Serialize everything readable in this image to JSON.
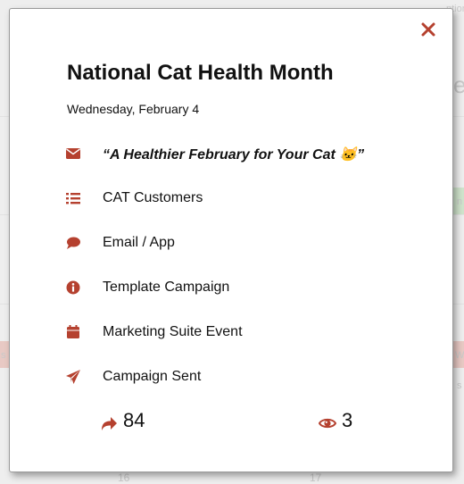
{
  "colors": {
    "accent": "#b5412f",
    "text": "#111111",
    "border": "#9a9a9a"
  },
  "background": {
    "fragments": [
      "ntion",
      "e",
      "n",
      "s",
      "W",
      "s",
      "16",
      "17"
    ]
  },
  "modal": {
    "close_icon": "close-icon",
    "title": "National Cat Health Month",
    "date": "Wednesday, February 4",
    "details": [
      {
        "icon": "envelope-icon",
        "text": "“A Healthier February for Your Cat 🐱”"
      },
      {
        "icon": "list-icon",
        "text": "CAT Customers"
      },
      {
        "icon": "comment-icon",
        "text": "Email / App"
      },
      {
        "icon": "info-circle-icon",
        "text": "Template Campaign"
      },
      {
        "icon": "calendar-icon",
        "text": "Marketing Suite Event"
      },
      {
        "icon": "paper-plane-icon",
        "text": "Campaign Sent"
      }
    ],
    "stats": {
      "shares": {
        "icon": "share-arrow-icon",
        "value": "84"
      },
      "views": {
        "icon": "eye-icon",
        "value": "3"
      }
    }
  }
}
